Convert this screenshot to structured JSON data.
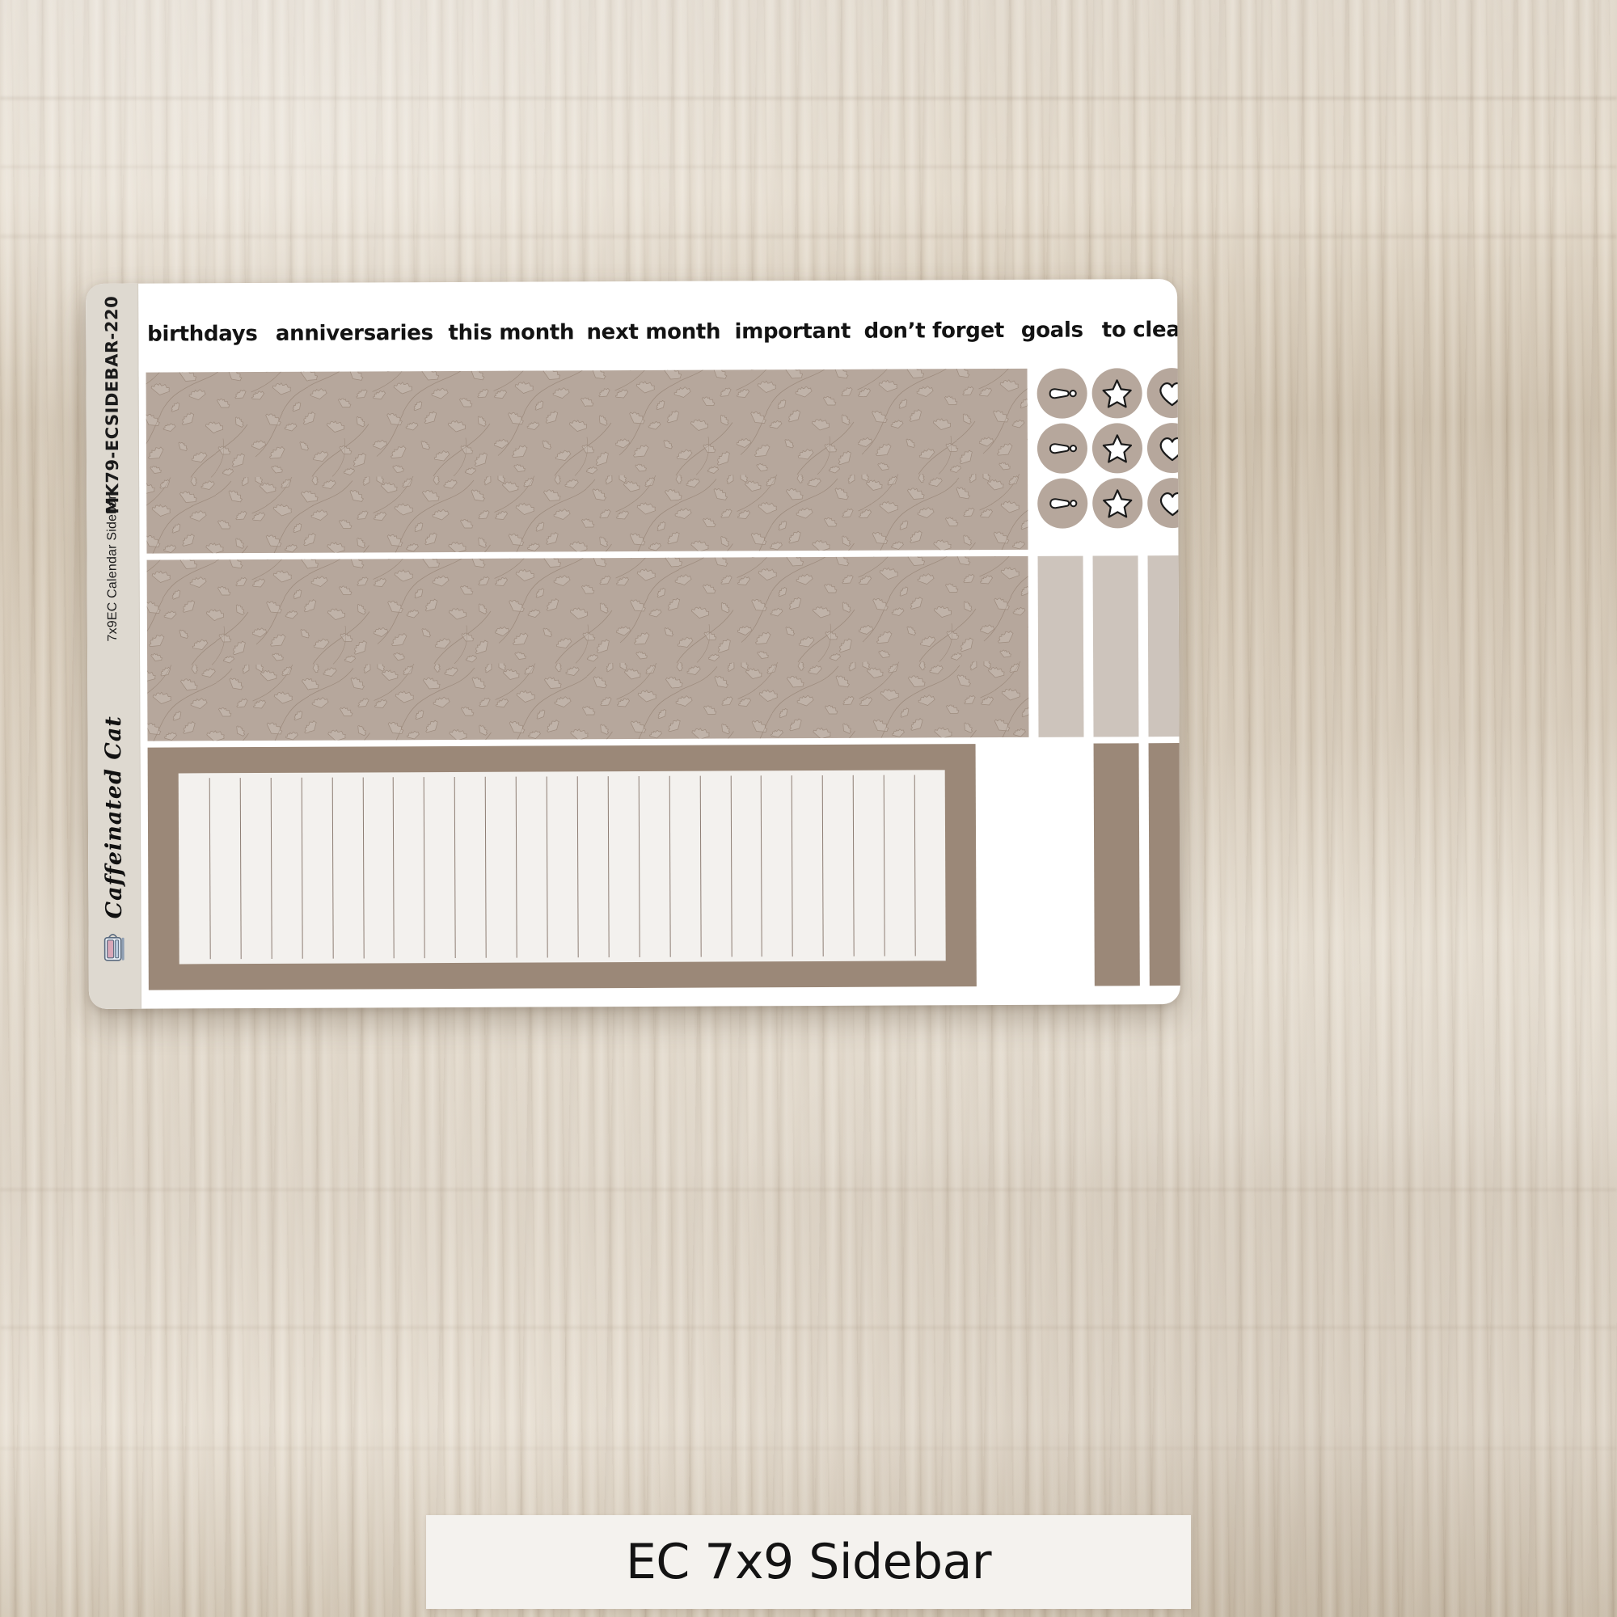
{
  "product": {
    "caption": "EC 7x9 Sidebar",
    "sheet_name": "7x9EC Calendar Sidebar",
    "sku": "MK79-ECSIDEBAR-220",
    "brand": "Caffeinated Cat",
    "brand_icon": "sticker-roll-icon"
  },
  "headers": [
    {
      "label": "birthdays"
    },
    {
      "label": "anniversaries"
    },
    {
      "label": "this month"
    },
    {
      "label": "next month"
    },
    {
      "label": "important"
    },
    {
      "label": "don’t forget"
    },
    {
      "label": "goals"
    },
    {
      "label": "to clean"
    }
  ],
  "panels": [
    {
      "name": "botanical-panel-top",
      "pattern": "ginkgo-leaf-line-art"
    },
    {
      "name": "botanical-panel-bottom",
      "pattern": "ginkgo-leaf-line-art"
    }
  ],
  "icon_stickers": {
    "rows": 3,
    "columns": 3,
    "icons": [
      "exclamation-icon",
      "star-icon",
      "heart-icon"
    ]
  },
  "light_bars": {
    "count": 3
  },
  "dark_bars": {
    "count": 2
  },
  "notes_box": {
    "name": "lined-notes-box",
    "divider_count": 24
  },
  "colors": {
    "sheet_white": "#ffffff",
    "side_strip": "#ded9d0",
    "botanical_fill": "#b6a79c",
    "light_bar": "#cdc4bc",
    "dark_bar": "#9b8878",
    "notes_inner": "#f3f1ee",
    "ink": "#131313",
    "desk": "#d8cdbc"
  }
}
